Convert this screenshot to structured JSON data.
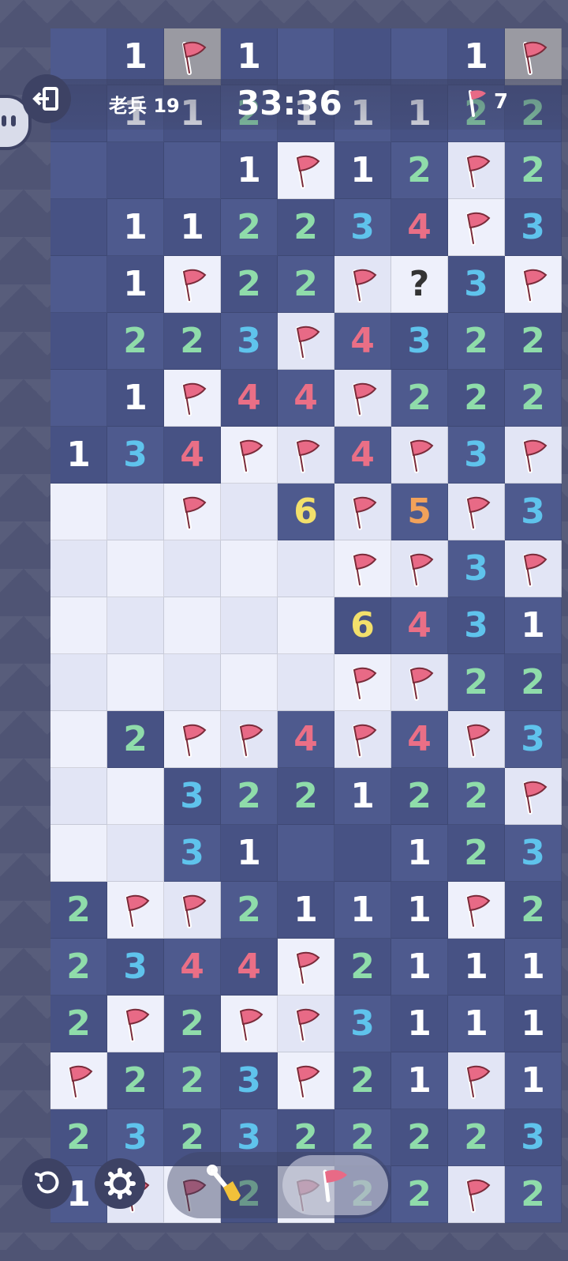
{
  "header": {
    "player_label": "老兵 19",
    "timer": "33:36",
    "flags_remaining": "7"
  },
  "colors": {
    "revealed_cell": "#4e5a8e",
    "hidden_cell": "#eef0fb",
    "flag_red": "#e86a86",
    "n1": "#ffffff",
    "n2": "#8fdcaa",
    "n3": "#5fc3ec",
    "n4": "#ea6f86",
    "n5": "#f2a25a",
    "n6": "#f3e06b"
  },
  "icons": {
    "exit": "exit-icon",
    "restart": "restart-icon",
    "settings": "gear-icon",
    "shovel": "shovel-icon",
    "flag": "flag-icon"
  },
  "board": {
    "legend": "N=revealed number, F=flag, G=gray flag, ?=question, e=revealed empty, h=hidden empty",
    "rows": [
      [
        "e",
        "1",
        "G",
        "1",
        "e",
        "e",
        "e",
        "1",
        "G"
      ],
      [
        "e",
        "1",
        "1",
        "2",
        "1",
        "1",
        "1",
        "2",
        "2"
      ],
      [
        "e",
        "e",
        "e",
        "1",
        "F",
        "1",
        "2",
        "F",
        "2"
      ],
      [
        "e",
        "1",
        "1",
        "2",
        "2",
        "3",
        "4",
        "F",
        "3"
      ],
      [
        "e",
        "1",
        "F",
        "2",
        "2",
        "F",
        "?",
        "3",
        "F"
      ],
      [
        "e",
        "2",
        "2",
        "3",
        "F",
        "4",
        "3",
        "2",
        "2"
      ],
      [
        "e",
        "1",
        "F",
        "4",
        "4",
        "F",
        "2",
        "2",
        "2"
      ],
      [
        "1",
        "3",
        "4",
        "F",
        "F",
        "4",
        "F",
        "3",
        "F"
      ],
      [
        "h",
        "h",
        "F",
        "h",
        "6",
        "F",
        "5",
        "F",
        "3"
      ],
      [
        "h",
        "h",
        "h",
        "h",
        "h",
        "F",
        "F",
        "3",
        "F"
      ],
      [
        "h",
        "h",
        "h",
        "h",
        "h",
        "6",
        "4",
        "3",
        "1"
      ],
      [
        "h",
        "h",
        "h",
        "h",
        "h",
        "F",
        "F",
        "2",
        "2"
      ],
      [
        "h",
        "2",
        "F",
        "F",
        "4",
        "F",
        "4",
        "F",
        "3"
      ],
      [
        "h",
        "h",
        "3",
        "2",
        "2",
        "1",
        "2",
        "2",
        "F"
      ],
      [
        "h",
        "h",
        "3",
        "1",
        "e",
        "e",
        "1",
        "2",
        "3"
      ],
      [
        "2",
        "F",
        "F",
        "2",
        "1",
        "1",
        "1",
        "F",
        "2"
      ],
      [
        "2",
        "3",
        "4",
        "4",
        "F",
        "2",
        "1",
        "1",
        "1"
      ],
      [
        "2",
        "F",
        "2",
        "F",
        "F",
        "3",
        "1",
        "1",
        "1"
      ],
      [
        "F",
        "2",
        "2",
        "3",
        "F",
        "2",
        "1",
        "F",
        "1"
      ],
      [
        "2",
        "3",
        "2",
        "3",
        "2",
        "2",
        "2",
        "2",
        "3"
      ],
      [
        "1",
        "F",
        "F",
        "2",
        "F",
        "2",
        "2",
        "F",
        "2"
      ]
    ]
  }
}
